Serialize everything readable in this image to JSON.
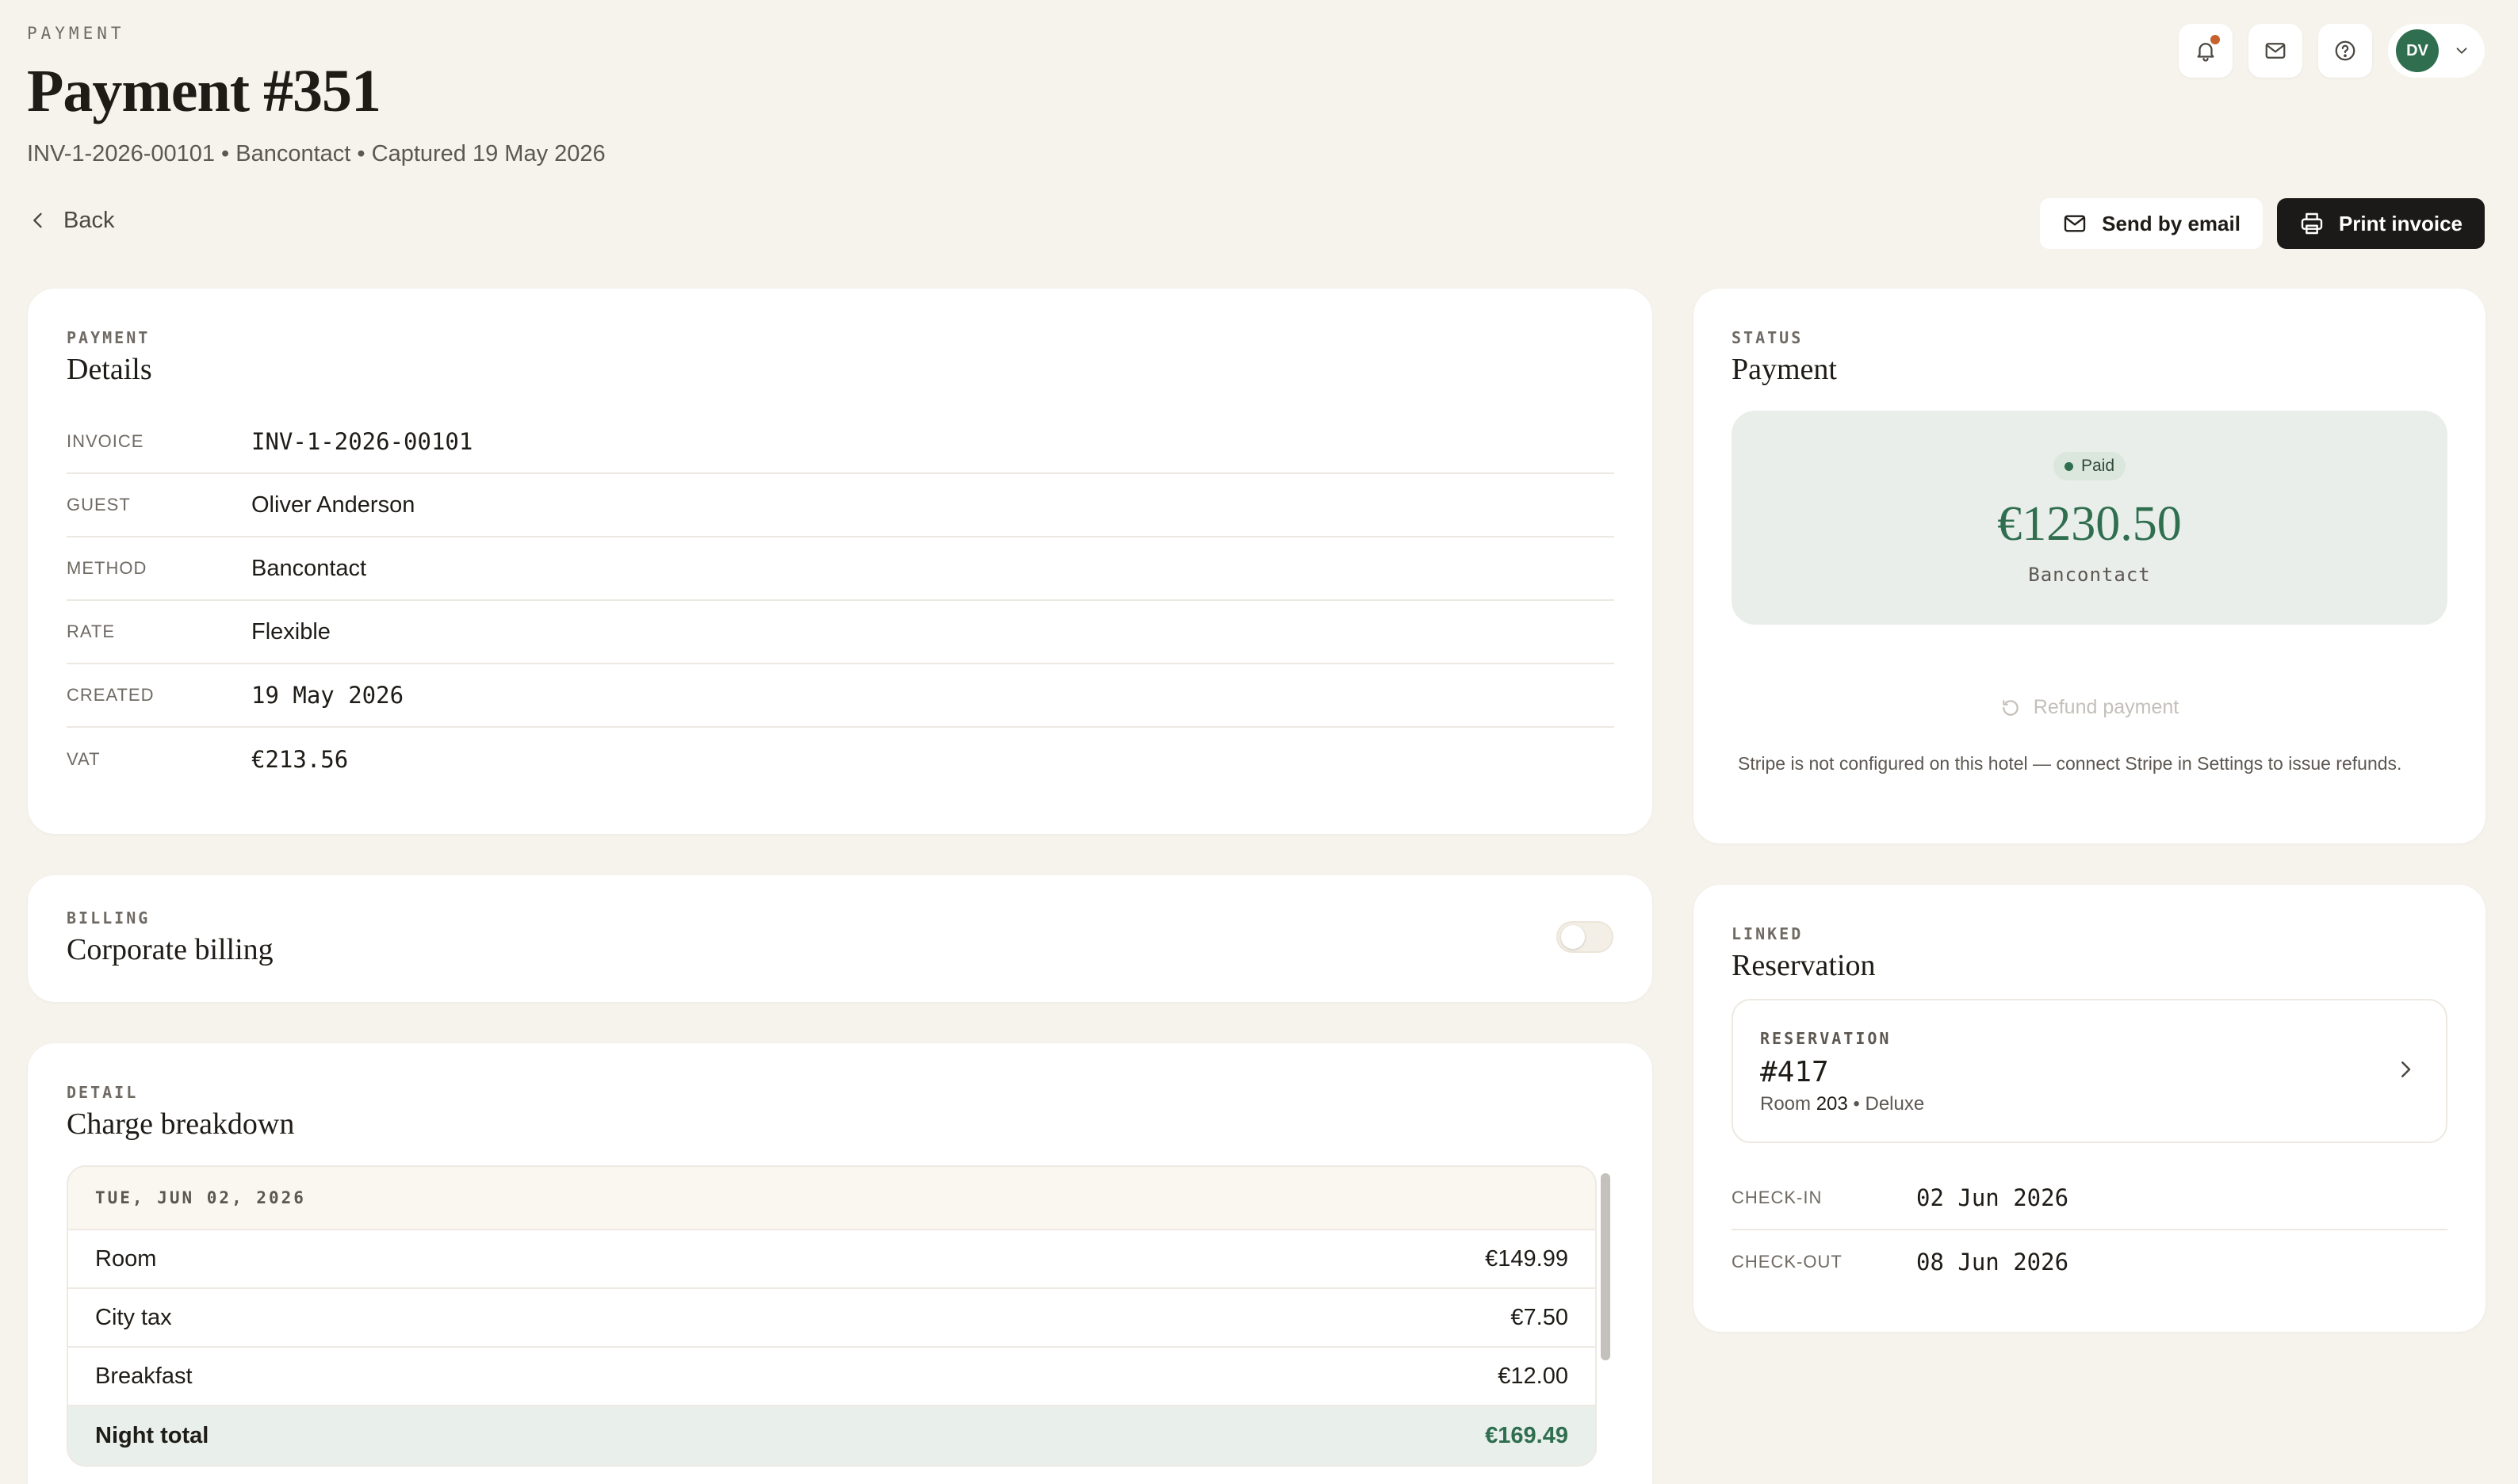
{
  "header": {
    "eyebrow": "PAYMENT",
    "title": "Payment #351",
    "subtitle": "INV-1-2026-00101 • Bancontact • Captured 19 May 2026",
    "back_label": "Back",
    "avatar_initials": "DV"
  },
  "actions": {
    "send_email": "Send by email",
    "print_invoice": "Print invoice"
  },
  "details": {
    "eyebrow": "PAYMENT",
    "title": "Details",
    "rows": [
      {
        "label": "INVOICE",
        "value": "INV-1-2026-00101"
      },
      {
        "label": "GUEST",
        "value": "Oliver Anderson"
      },
      {
        "label": "METHOD",
        "value": "Bancontact"
      },
      {
        "label": "RATE",
        "value": "Flexible"
      },
      {
        "label": "CREATED",
        "value": "19 May 2026"
      },
      {
        "label": "VAT",
        "value": "€213.56"
      }
    ]
  },
  "billing": {
    "eyebrow": "BILLING",
    "title": "Corporate billing",
    "enabled": false
  },
  "breakdown": {
    "eyebrow": "DETAIL",
    "title": "Charge breakdown",
    "date": "TUE, JUN 02, 2026",
    "rows": [
      {
        "label": "Room",
        "amount": "€149.99"
      },
      {
        "label": "City tax",
        "amount": "€7.50"
      },
      {
        "label": "Breakfast",
        "amount": "€12.00"
      }
    ],
    "total": {
      "label": "Night total",
      "amount": "€169.49"
    }
  },
  "status": {
    "eyebrow": "STATUS",
    "title": "Payment",
    "badge": "Paid",
    "amount": "€1230.50",
    "method": "Bancontact",
    "refund_label": "Refund payment",
    "note": "Stripe is not configured on this hotel — connect Stripe in Settings to issue refunds."
  },
  "linked": {
    "eyebrow": "LINKED",
    "title": "Reservation",
    "reservation_eyebrow": "RESERVATION",
    "reservation_number": "#417",
    "room_prefix": "Room",
    "room_number": "203",
    "room_type": "• Deluxe",
    "checkin_label": "CHECK-IN",
    "checkin_value": "02 Jun 2026",
    "checkout_label": "CHECK-OUT",
    "checkout_value": "08 Jun 2026"
  },
  "colors": {
    "background": "#f6f2ec",
    "accent_green": "#2f6e4f",
    "notification_dot": "#c7622d",
    "dark_button": "#1c1a18"
  }
}
